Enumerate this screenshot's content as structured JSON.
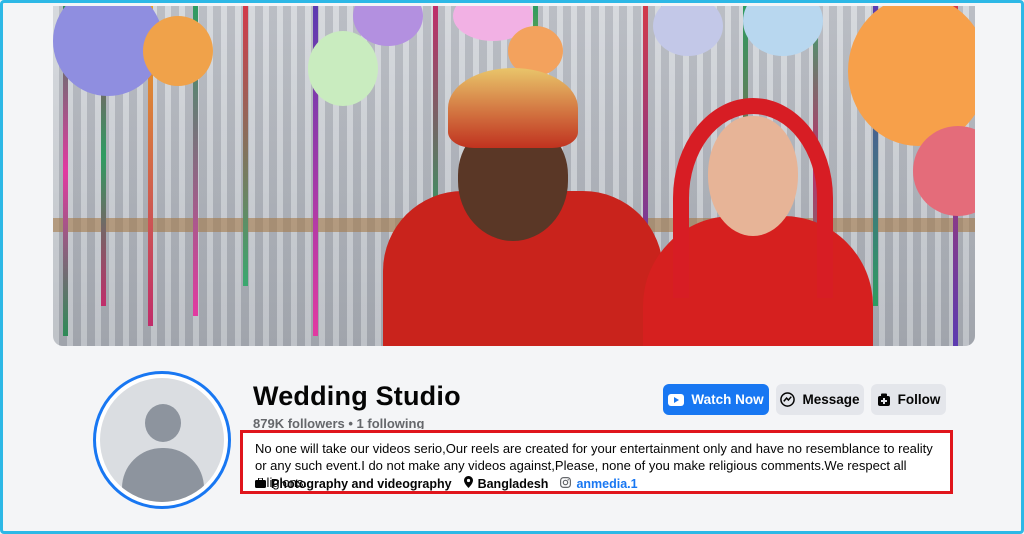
{
  "page": {
    "name": "Wedding Studio",
    "stats": "879K followers • 1 following"
  },
  "actions": {
    "watch_label": "Watch Now",
    "message_label": "Message",
    "follow_label": "Follow"
  },
  "bio": {
    "text": "No one will take our videos serio,Our reels are created for your entertainment only and have no resemblance to reality or any such event.I do not make any videos against,Please, none of you make religious comments.We respect all religions."
  },
  "details": {
    "category": "Photography and videography",
    "location": "Bangladesh",
    "instagram": "anmedia.1"
  },
  "colors": {
    "accent": "#1877f2",
    "highlight_border": "#e0151c",
    "frame_border": "#2db8e6"
  },
  "icons": [
    "video-play-icon",
    "messenger-icon",
    "follow-icon",
    "briefcase-icon",
    "location-pin-icon",
    "instagram-icon"
  ]
}
